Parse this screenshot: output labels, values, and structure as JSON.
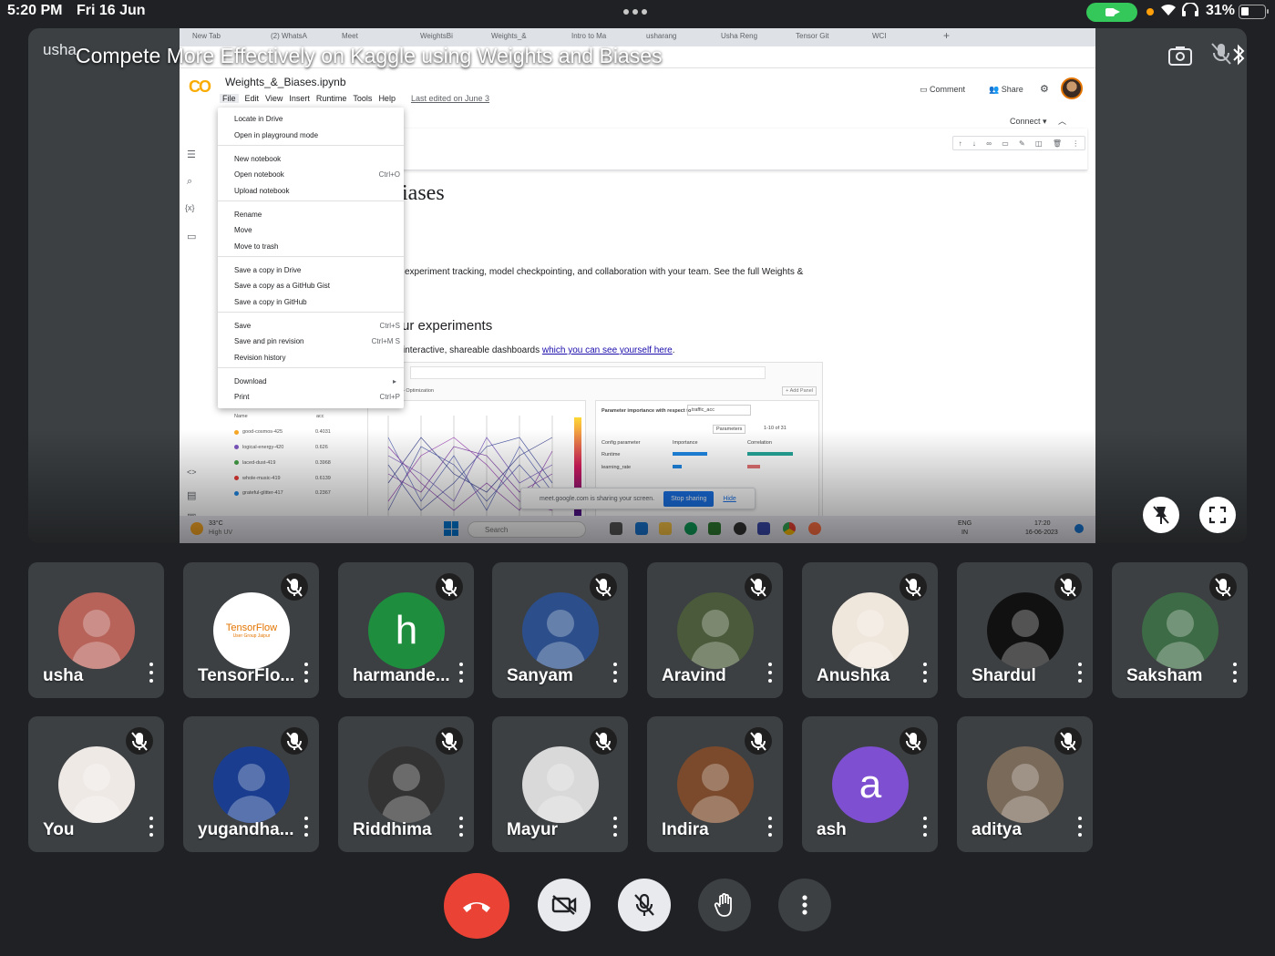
{
  "status_bar": {
    "time": "5:20 PM",
    "date": "Fri 16 Jun",
    "battery": "31%",
    "camera_indicator_color": "#34c759"
  },
  "presentation": {
    "presenter_name": "usha",
    "overlay_title": "Compete More Effectively on Kaggle using Weights and Biases",
    "browser_tabs": [
      "New Tab",
      "(2) WhatsA",
      "Meet",
      "WeightsBi",
      "Weights_&",
      "Intro to Ma",
      "usharang",
      "Usha Reng",
      "Tensor Git",
      "WCI"
    ],
    "colab": {
      "notebook_name": "Weights_&_Biases.ipynb",
      "logo": "CO",
      "menu": [
        "File",
        "Edit",
        "View",
        "Insert",
        "Runtime",
        "Tools",
        "Help"
      ],
      "last_edited": "Last edited on June 3",
      "comment_label": "Comment",
      "share_label": "Share",
      "connect_label": "Connect",
      "heading_fragment": "iases",
      "para1": "experiment tracking, model checkpointing, and collaboration with your team. See the full Weights &",
      "heading2_fragment": "ur experiments",
      "para2_prefix": "interactive, shareable dashboards",
      "para2_link": "which you can see yourself here",
      "para2_suffix": "."
    },
    "file_menu": [
      {
        "label": "Locate in Drive",
        "shortcut": ""
      },
      {
        "label": "Open in playground mode",
        "shortcut": ""
      },
      {
        "label": "New notebook",
        "shortcut": ""
      },
      {
        "label": "Open notebook",
        "shortcut": "Ctrl+O"
      },
      {
        "label": "Upload notebook",
        "shortcut": ""
      },
      {
        "label": "Rename",
        "shortcut": ""
      },
      {
        "label": "Move",
        "shortcut": ""
      },
      {
        "label": "Move to trash",
        "shortcut": ""
      },
      {
        "label": "Save a copy in Drive",
        "shortcut": ""
      },
      {
        "label": "Save a copy as a GitHub Gist",
        "shortcut": ""
      },
      {
        "label": "Save a copy in GitHub",
        "shortcut": ""
      },
      {
        "label": "Save",
        "shortcut": "Ctrl+S"
      },
      {
        "label": "Save and pin revision",
        "shortcut": "Ctrl+M S"
      },
      {
        "label": "Revision history",
        "shortcut": ""
      },
      {
        "label": "Download",
        "shortcut": "▸"
      },
      {
        "label": "Print",
        "shortcut": "Ctrl+P"
      }
    ],
    "runs": {
      "header": [
        "Name",
        "acc"
      ],
      "rows": [
        {
          "name": "good-cosmos-425",
          "acc": "0.4031",
          "color": "#f9a825"
        },
        {
          "name": "logical-energy-420",
          "acc": "0.626",
          "color": "#7e57c2"
        },
        {
          "name": "laced-dust-419",
          "acc": "0.3968",
          "color": "#43a047"
        },
        {
          "name": "whole-music-419",
          "acc": "0.6139",
          "color": "#e53935"
        },
        {
          "name": "grateful-glitter-417",
          "acc": "0.2367",
          "color": "#1e88e5"
        }
      ]
    },
    "importance_panel": {
      "title": "Parameter importance with respect to",
      "metric": "traffic_acc",
      "params_button": "Parameters",
      "pager": "1-10 of 31",
      "col_headers": [
        "Config parameter",
        "Importance",
        "Correlation"
      ],
      "rows": [
        "Runtime",
        "learning_rate"
      ]
    },
    "dashboard_optimization_label": "Optimization",
    "add_panel_label": "+ Add Panel",
    "share_banner": {
      "text": "meet.google.com is sharing your screen.",
      "stop": "Stop sharing",
      "hide": "Hide"
    },
    "taskbar": {
      "weather_temp": "33°C",
      "weather_desc": "High UV",
      "search": "Search",
      "lang": "ENG",
      "lang_region": "IN",
      "clock_time": "17:20",
      "clock_date": "16-06-2023"
    }
  },
  "participants": [
    {
      "name": "usha",
      "avatar_bg": "#b7635a",
      "initial": "",
      "muted": false
    },
    {
      "name": "TensorFlo...",
      "avatar_bg": "#ffffff",
      "initial": "",
      "muted": true,
      "logo_text": "TensorFlow",
      "logo_sub": "User Group Jaipur"
    },
    {
      "name": "harmande...",
      "avatar_bg": "#1e8e3e",
      "initial": "h",
      "muted": true
    },
    {
      "name": "Sanyam",
      "avatar_bg": "#2c4f8c",
      "initial": "",
      "muted": true
    },
    {
      "name": "Aravind",
      "avatar_bg": "#4a5a3a",
      "initial": "",
      "muted": true
    },
    {
      "name": "Anushka",
      "avatar_bg": "#efe6dc",
      "initial": "",
      "muted": true
    },
    {
      "name": "Shardul",
      "avatar_bg": "#111111",
      "initial": "",
      "muted": true
    },
    {
      "name": "Saksham",
      "avatar_bg": "#3d6b45",
      "initial": "",
      "muted": true
    },
    {
      "name": "You",
      "avatar_bg": "#efe9e6",
      "initial": "",
      "muted": true
    },
    {
      "name": "yugandha...",
      "avatar_bg": "#1a3d8f",
      "initial": "",
      "muted": true
    },
    {
      "name": "Riddhima",
      "avatar_bg": "#333333",
      "initial": "",
      "muted": true
    },
    {
      "name": "Mayur",
      "avatar_bg": "#d9d9d9",
      "initial": "",
      "muted": true
    },
    {
      "name": "Indira",
      "avatar_bg": "#7b4a2c",
      "initial": "",
      "muted": true
    },
    {
      "name": "ash",
      "avatar_bg": "#7e4fd0",
      "initial": "a",
      "muted": true
    },
    {
      "name": "aditya",
      "avatar_bg": "#7a6a5a",
      "initial": "",
      "muted": true
    }
  ],
  "controls": {
    "end_call_color": "#ea4335",
    "icons": [
      "end-call-icon",
      "camera-off-icon",
      "mic-off-icon",
      "raise-hand-icon",
      "more-options-icon"
    ]
  }
}
